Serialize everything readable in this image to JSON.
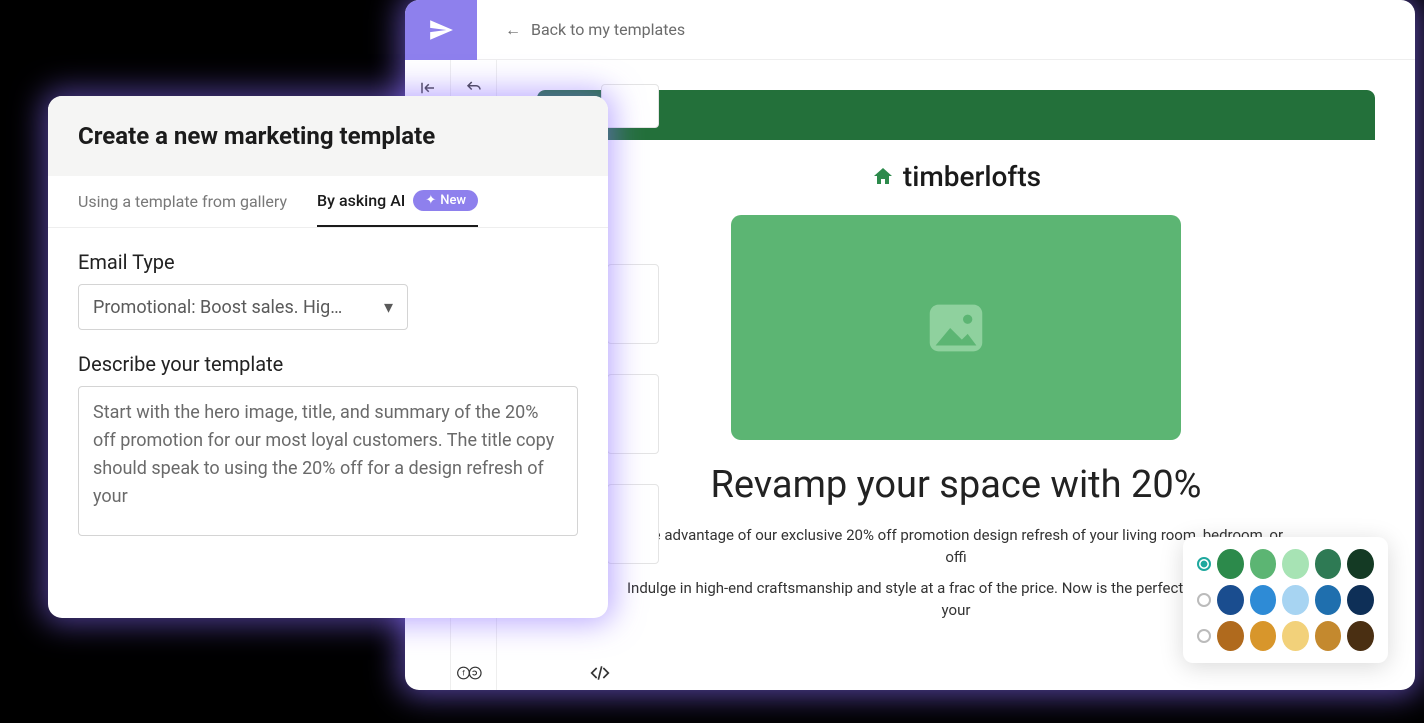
{
  "topbar": {
    "back_label": "Back to my templates"
  },
  "modal": {
    "title": "Create a new marketing template",
    "tabs": {
      "gallery": "Using a template from gallery",
      "ai": "By asking AI",
      "new_badge": "New"
    },
    "email_type_label": "Email Type",
    "email_type_value": "Promotional: Boost sales. Hig…",
    "describe_label": "Describe your template",
    "describe_value": "Start with the hero image, title, and summary of the 20% off promotion for our most loyal customers. The title copy should speak to using the 20% off for a design refresh of your"
  },
  "preview": {
    "brand_name": "timberlofts",
    "title": "Revamp your space with 20%",
    "para1": "Take advantage of our exclusive 20% off promotion design refresh of your living room, bedroom, or offi",
    "para2": "Indulge in high-end craftsmanship and style at a frac of the price. Now is the perfect time to elevate your"
  },
  "palette": {
    "row1": [
      "#2c8a4b",
      "#5cb573",
      "#a7e3b4",
      "#2e7a54",
      "#143a24"
    ],
    "row2": [
      "#1a4d8f",
      "#2e8bd6",
      "#a7d4f2",
      "#1f6fae",
      "#0e2f57"
    ],
    "row3": [
      "#b06a1d",
      "#d8962b",
      "#f2d17a",
      "#c4892e",
      "#4a2f12"
    ]
  }
}
